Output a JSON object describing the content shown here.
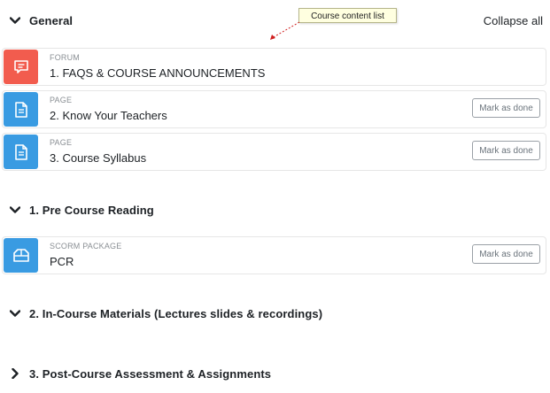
{
  "header": {
    "section_title": "General",
    "collapse_all_label": "Collapse all",
    "tooltip_text": "Course content list"
  },
  "general": {
    "activities": [
      {
        "type": "FORUM",
        "name": "1. FAQS & COURSE ANNOUNCEMENTS",
        "icon": "forum-icon",
        "color": "#f25c4e"
      },
      {
        "type": "PAGE",
        "name": "2. Know Your Teachers",
        "icon": "page-icon",
        "color": "#399be2",
        "button": "Mark as done"
      },
      {
        "type": "PAGE",
        "name": "3. Course Syllabus",
        "icon": "page-icon",
        "color": "#399be2",
        "button": "Mark as done"
      }
    ]
  },
  "section1": {
    "title": "1. Pre Course Reading",
    "activities": [
      {
        "type": "SCORM PACKAGE",
        "name": "PCR",
        "icon": "scorm-package-icon",
        "color": "#399be2",
        "button": "Mark as done"
      }
    ]
  },
  "section2": {
    "title": "2. In-Course Materials (Lectures slides & recordings)"
  },
  "section3": {
    "title": "3. Post-Course Assessment & Assignments"
  }
}
